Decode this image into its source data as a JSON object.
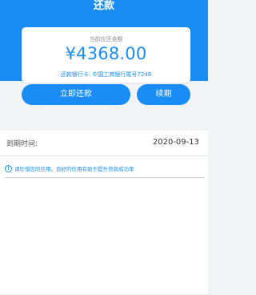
{
  "header": {
    "title": "还款",
    "accent_color": "#1a8cf5"
  },
  "card": {
    "due_label": "当前应还金额",
    "amount": "¥4368.00",
    "bank_line": "还款银行卡: 中国工商银行尾号7248"
  },
  "actions": {
    "repay_label": "立即还款",
    "renew_label": "续期"
  },
  "due_date": {
    "label": "到期时间:",
    "value": "2020-09-13"
  },
  "tip": {
    "icon": "info-icon",
    "text": "请珍惜您的信用，良好的信用有助于提升贷款成功率"
  }
}
